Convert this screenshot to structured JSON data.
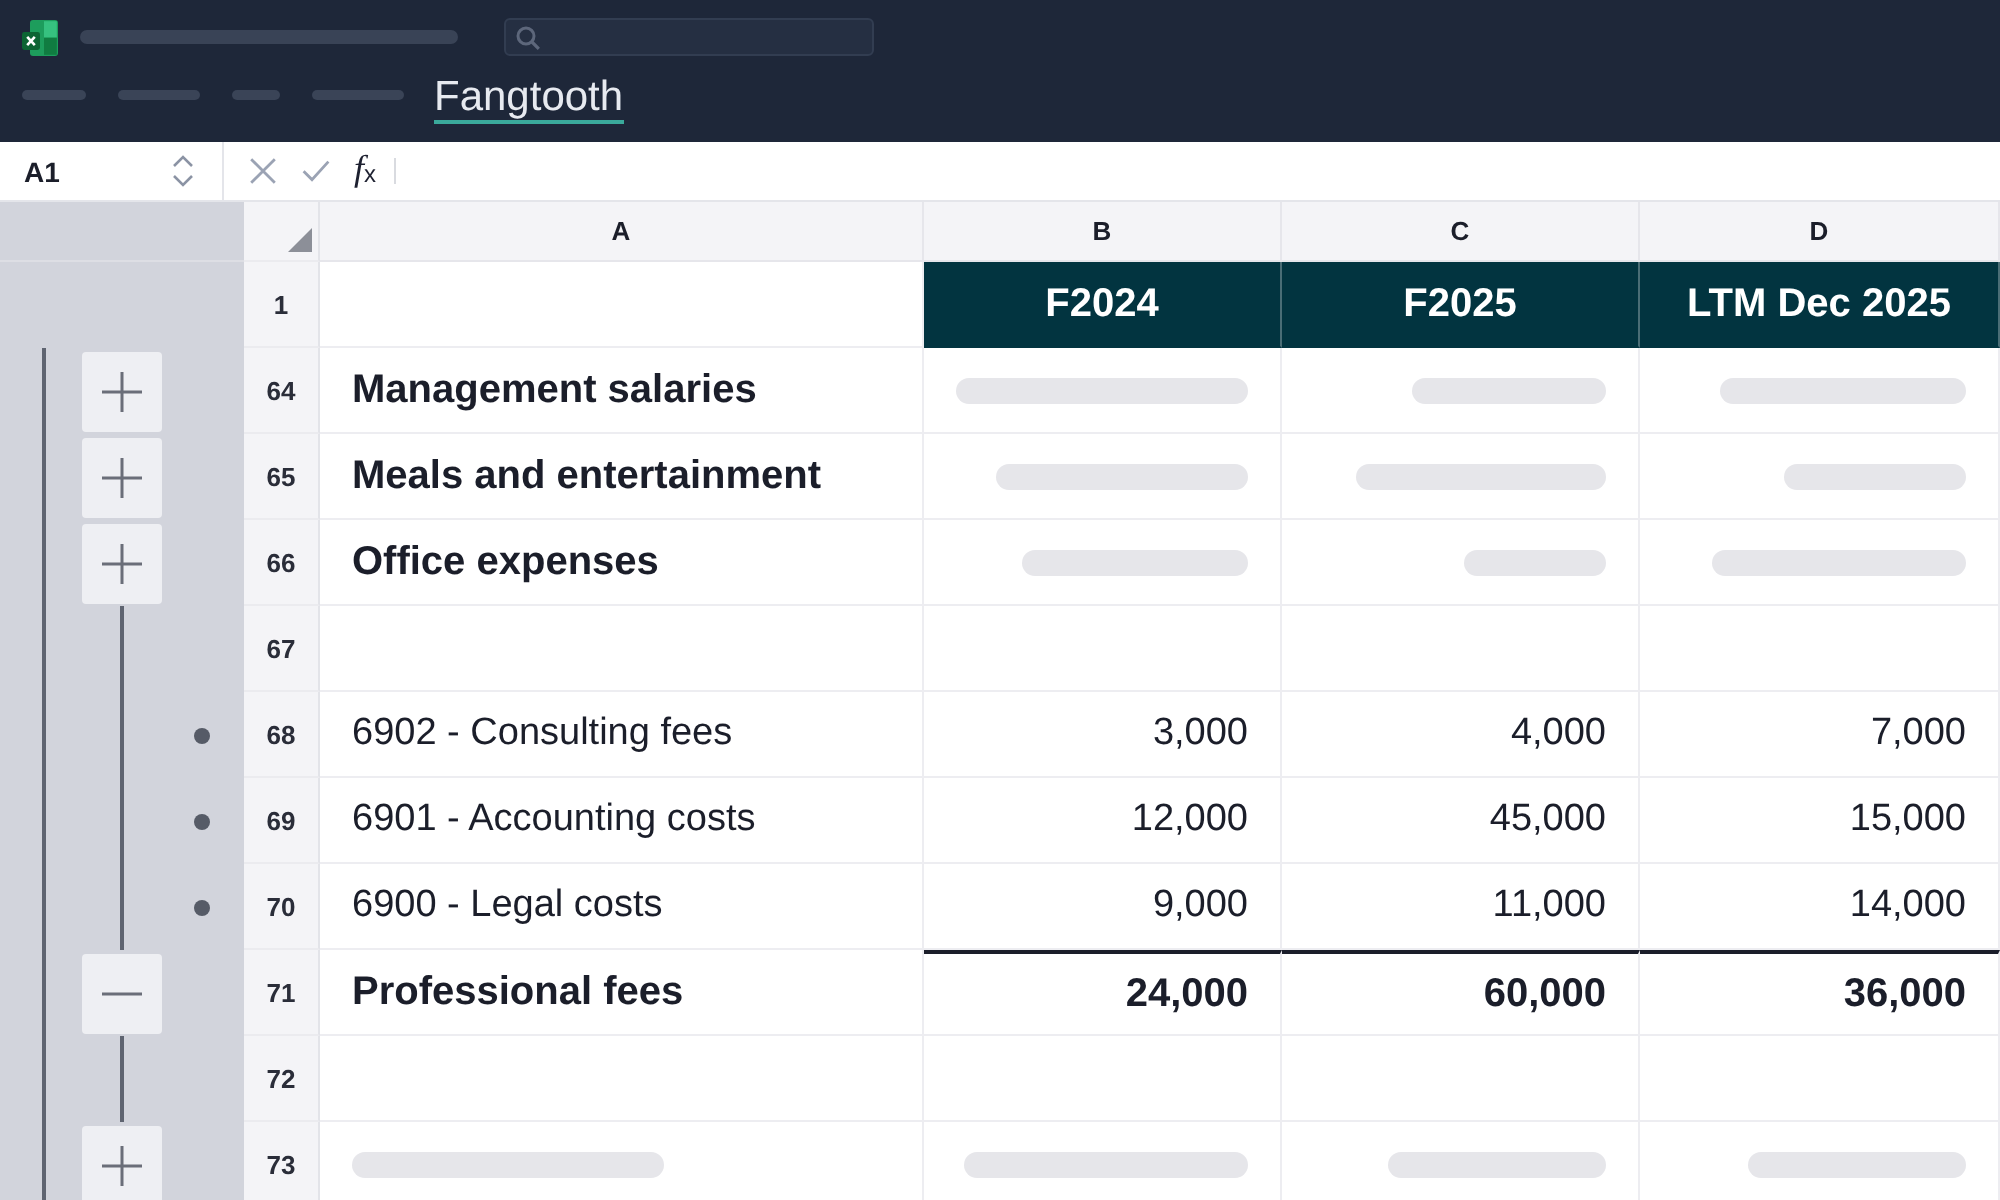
{
  "app_bar": {
    "title_skeleton": true,
    "search_field": true,
    "ribbon_tabs": [
      {
        "kind": "skeleton",
        "selected": false
      },
      {
        "kind": "skeleton",
        "selected": false
      },
      {
        "kind": "skeleton",
        "selected": false
      },
      {
        "kind": "skeleton",
        "selected": false
      },
      {
        "kind": "label",
        "label": "Fangtooth",
        "selected": true
      }
    ]
  },
  "formula_bar": {
    "name_box": "A1",
    "function_label": "f$_{x}$"
  },
  "columns": [
    "A",
    "B",
    "C",
    "D"
  ],
  "rows": [
    {
      "number": "1",
      "kind": "header",
      "cells": [
        {
          "kind": "empty"
        },
        {
          "kind": "text",
          "text": "F2024"
        },
        {
          "kind": "text",
          "text": "F2025"
        },
        {
          "kind": "text",
          "text": "LTM Dec 2025"
        }
      ]
    },
    {
      "number": "64",
      "kind": "group",
      "outline": {
        "kind": "button",
        "expanded": false
      },
      "cells": [
        {
          "kind": "text",
          "text": "Management salaries"
        },
        {
          "kind": "skeleton"
        },
        {
          "kind": "skeleton"
        },
        {
          "kind": "skeleton"
        }
      ]
    },
    {
      "number": "65",
      "kind": "group",
      "outline": {
        "kind": "button",
        "expanded": false
      },
      "cells": [
        {
          "kind": "text",
          "text": "Meals and entertainment"
        },
        {
          "kind": "skeleton"
        },
        {
          "kind": "skeleton"
        },
        {
          "kind": "skeleton"
        }
      ]
    },
    {
      "number": "66",
      "kind": "group",
      "outline": {
        "kind": "button",
        "expanded": false
      },
      "cells": [
        {
          "kind": "text",
          "text": "Office expenses"
        },
        {
          "kind": "skeleton"
        },
        {
          "kind": "skeleton"
        },
        {
          "kind": "skeleton"
        }
      ]
    },
    {
      "number": "67",
      "kind": "detail",
      "outline": {
        "kind": "line"
      },
      "cells": [
        {
          "kind": "empty"
        },
        {
          "kind": "empty"
        },
        {
          "kind": "empty"
        },
        {
          "kind": "empty"
        }
      ]
    },
    {
      "number": "68",
      "kind": "detail",
      "outline": {
        "kind": "dot"
      },
      "cells": [
        {
          "kind": "text",
          "text": "6902 - Consulting fees"
        },
        {
          "kind": "text",
          "text": "3,000"
        },
        {
          "kind": "text",
          "text": "4,000"
        },
        {
          "kind": "text",
          "text": "7,000"
        }
      ]
    },
    {
      "number": "69",
      "kind": "detail",
      "outline": {
        "kind": "dot"
      },
      "cells": [
        {
          "kind": "text",
          "text": "6901 - Accounting costs"
        },
        {
          "kind": "text",
          "text": "12,000"
        },
        {
          "kind": "text",
          "text": "45,000"
        },
        {
          "kind": "text",
          "text": "15,000"
        }
      ]
    },
    {
      "number": "70",
      "kind": "detail",
      "outline": {
        "kind": "dot"
      },
      "cells": [
        {
          "kind": "text",
          "text": "6900 - Legal costs"
        },
        {
          "kind": "text",
          "text": "9,000"
        },
        {
          "kind": "text",
          "text": "11,000"
        },
        {
          "kind": "text",
          "text": "14,000"
        }
      ]
    },
    {
      "number": "71",
      "kind": "total",
      "outline": {
        "kind": "button",
        "expanded": true
      },
      "cells": [
        {
          "kind": "text",
          "text": "Professional fees"
        },
        {
          "kind": "text",
          "text": "24,000"
        },
        {
          "kind": "text",
          "text": "60,000"
        },
        {
          "kind": "text",
          "text": "36,000"
        }
      ]
    },
    {
      "number": "72",
      "kind": "detail",
      "outline": {
        "kind": "line"
      },
      "cells": [
        {
          "kind": "empty"
        },
        {
          "kind": "empty"
        },
        {
          "kind": "empty"
        },
        {
          "kind": "empty"
        }
      ]
    },
    {
      "number": "73",
      "kind": "group",
      "outline": {
        "kind": "button",
        "expanded": false
      },
      "cells": [
        {
          "kind": "skeleton"
        },
        {
          "kind": "skeleton"
        },
        {
          "kind": "skeleton"
        },
        {
          "kind": "skeleton"
        }
      ]
    }
  ]
}
